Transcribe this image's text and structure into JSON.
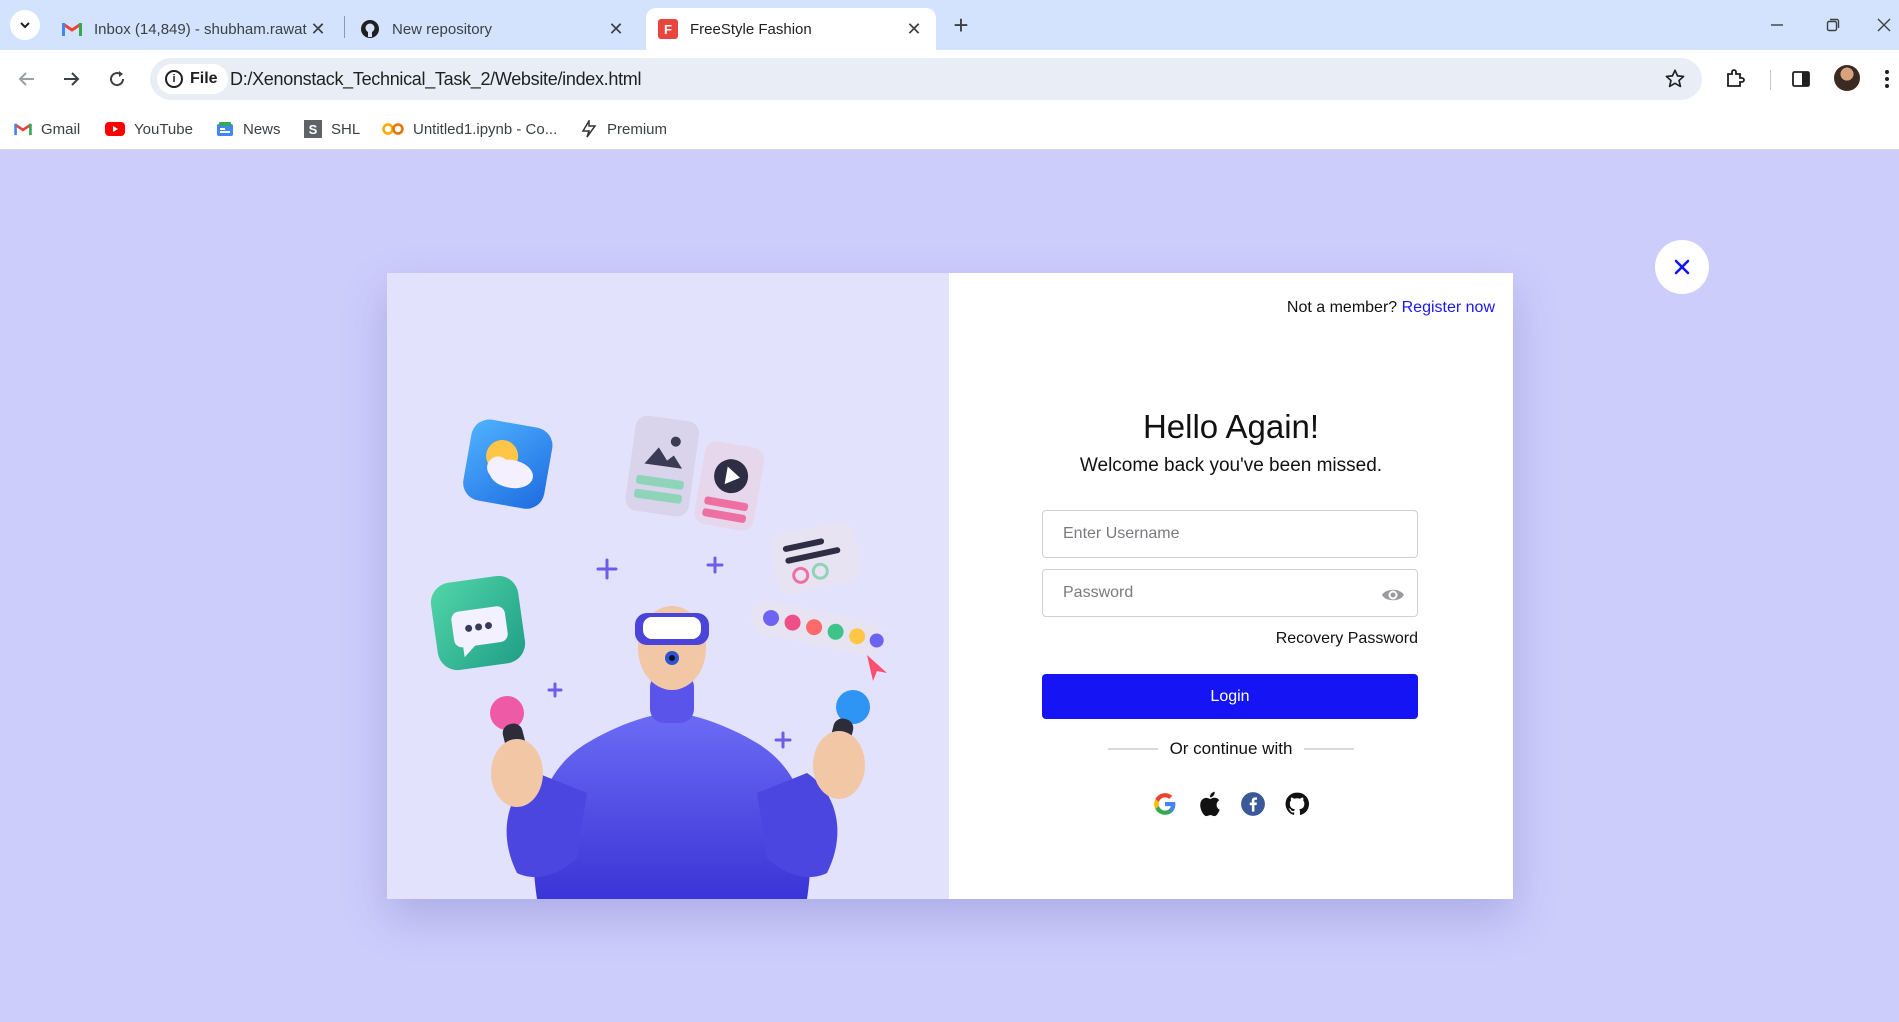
{
  "browser": {
    "tabs": [
      {
        "title": "Inbox (14,849) - shubham.rawat",
        "icon": "gmail-icon",
        "active": false
      },
      {
        "title": "New repository",
        "icon": "github-icon",
        "active": false
      },
      {
        "title": "FreeStyle Fashion",
        "icon": "freestyle-icon",
        "active": true
      }
    ],
    "favicon_letter": "F",
    "address": {
      "chip_label": "File",
      "url": "D:/Xenonstack_Technical_Task_2/Website/index.html"
    },
    "bookmarks": [
      {
        "label": "Gmail",
        "icon": "gmail-icon"
      },
      {
        "label": "YouTube",
        "icon": "youtube-icon"
      },
      {
        "label": "News",
        "icon": "news-icon"
      },
      {
        "label": "SHL",
        "icon": "shl-icon"
      },
      {
        "label": "Untitled1.ipynb - Co...",
        "icon": "colab-icon"
      },
      {
        "label": "Premium",
        "icon": "premium-icon"
      }
    ]
  },
  "login": {
    "not_member": "Not a member?",
    "register_link": "Register now",
    "heading": "Hello Again!",
    "subheading": "Welcome back you've been missed.",
    "username_placeholder": "Enter Username",
    "password_placeholder": "Password",
    "recovery": "Recovery Password",
    "login_button": "Login",
    "divider_text": "Or continue with",
    "social_icons": [
      "google-icon",
      "apple-icon",
      "facebook-icon",
      "github-icon"
    ]
  },
  "colors": {
    "page_bg": "#cccdfb",
    "illustration_bg": "#e3e2fd",
    "primary": "#1414f5",
    "register_link": "#1a16f5"
  }
}
